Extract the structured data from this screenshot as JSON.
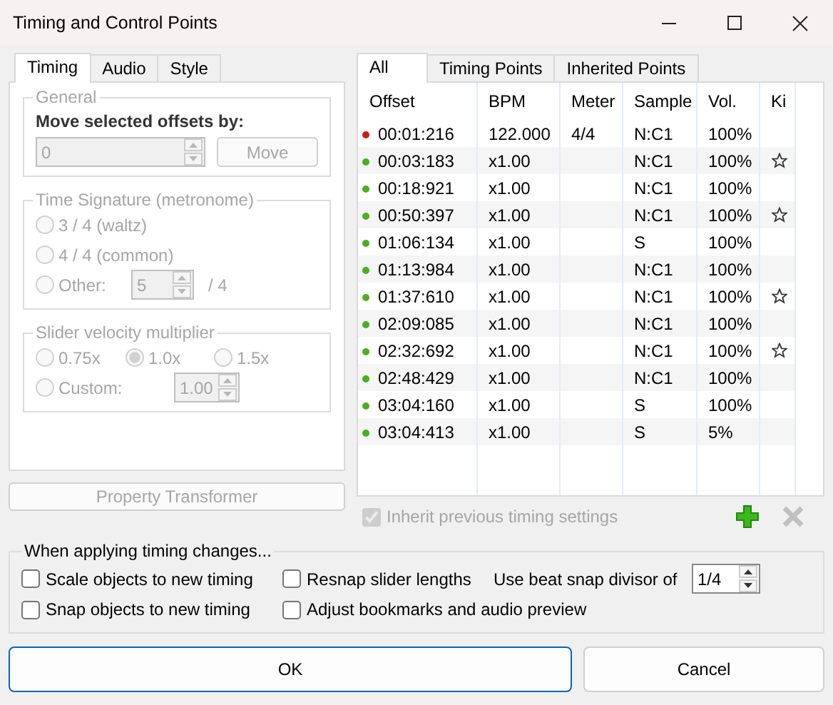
{
  "window": {
    "title": "Timing and Control Points"
  },
  "left_tabs": [
    {
      "label": "Timing",
      "selected": true
    },
    {
      "label": "Audio",
      "selected": false
    },
    {
      "label": "Style",
      "selected": false
    }
  ],
  "general": {
    "legend": "General",
    "disabled": true,
    "label": "Move selected offsets by:",
    "value": "0",
    "button": "Move"
  },
  "time_signature": {
    "legend": "Time Signature (metronome)",
    "disabled": true,
    "options": [
      {
        "label": "3 / 4 (waltz)",
        "checked": false
      },
      {
        "label": "4 / 4 (common)",
        "checked": false
      },
      {
        "label": "Other:",
        "checked": false,
        "value": "5",
        "suffix": "/ 4"
      }
    ]
  },
  "slider_velocity": {
    "legend": "Slider velocity multiplier",
    "disabled": true,
    "options": [
      {
        "label": "0.75x",
        "checked": false
      },
      {
        "label": "1.0x",
        "checked": true
      },
      {
        "label": "1.5x",
        "checked": false
      },
      {
        "label": "Custom:",
        "checked": false,
        "value": "1.00"
      }
    ]
  },
  "property_transformer": {
    "label": "Property Transformer",
    "disabled": true
  },
  "right_tabs": [
    {
      "label": "All",
      "selected": true
    },
    {
      "label": "Timing Points",
      "selected": false
    },
    {
      "label": "Inherited Points",
      "selected": false
    }
  ],
  "table": {
    "columns": [
      "Offset",
      "BPM",
      "Meter",
      "Sample",
      "Vol.",
      "Ki"
    ],
    "rows": [
      {
        "color": "#c8200c",
        "offset": "00:01:216",
        "bpm": "122.000",
        "meter": "4/4",
        "sample": "N:C1",
        "volume": "100%",
        "kiai": false
      },
      {
        "color": "#4caf1c",
        "offset": "00:03:183",
        "bpm": "x1.00",
        "sample": "N:C1",
        "volume": "100%",
        "kiai": true
      },
      {
        "color": "#4caf1c",
        "offset": "00:18:921",
        "bpm": "x1.00",
        "sample": "N:C1",
        "volume": "100%",
        "kiai": false
      },
      {
        "color": "#4caf1c",
        "offset": "00:50:397",
        "bpm": "x1.00",
        "sample": "N:C1",
        "volume": "100%",
        "kiai": true
      },
      {
        "color": "#4caf1c",
        "offset": "01:06:134",
        "bpm": "x1.00",
        "sample": "S",
        "volume": "100%",
        "kiai": false
      },
      {
        "color": "#4caf1c",
        "offset": "01:13:984",
        "bpm": "x1.00",
        "sample": "N:C1",
        "volume": "100%",
        "kiai": false
      },
      {
        "color": "#4caf1c",
        "offset": "01:37:610",
        "bpm": "x1.00",
        "sample": "N:C1",
        "volume": "100%",
        "kiai": true
      },
      {
        "color": "#4caf1c",
        "offset": "02:09:085",
        "bpm": "x1.00",
        "sample": "N:C1",
        "volume": "100%",
        "kiai": false
      },
      {
        "color": "#4caf1c",
        "offset": "02:32:692",
        "bpm": "x1.00",
        "sample": "N:C1",
        "volume": "100%",
        "kiai": true
      },
      {
        "color": "#4caf1c",
        "offset": "02:48:429",
        "bpm": "x1.00",
        "sample": "N:C1",
        "volume": "100%",
        "kiai": false
      },
      {
        "color": "#4caf1c",
        "offset": "03:04:160",
        "bpm": "x1.00",
        "sample": "S",
        "volume": "100%",
        "kiai": false
      },
      {
        "color": "#4caf1c",
        "offset": "03:04:413",
        "bpm": "x1.00",
        "sample": "S",
        "volume": "5%",
        "kiai": false
      }
    ]
  },
  "inherit": {
    "label": "Inherit previous timing settings",
    "checked": true,
    "disabled": true
  },
  "point_actions": [
    {
      "kind": "add",
      "disabled": false
    },
    {
      "kind": "delete",
      "disabled": true
    }
  ],
  "apply_changes": {
    "legend": "When applying timing changes...",
    "options": [
      {
        "label": "Scale objects to new timing",
        "checked": false
      },
      {
        "label": "Resnap slider lengths",
        "checked": false
      },
      {
        "label": "Snap objects to new timing",
        "checked": false
      },
      {
        "label": "Adjust bookmarks and audio preview",
        "checked": false
      }
    ],
    "divisor_label": "Use beat snap divisor of",
    "divisor_value": "1/4"
  },
  "buttons": [
    {
      "label": "OK",
      "default": true
    },
    {
      "label": "Cancel",
      "default": false
    }
  ]
}
